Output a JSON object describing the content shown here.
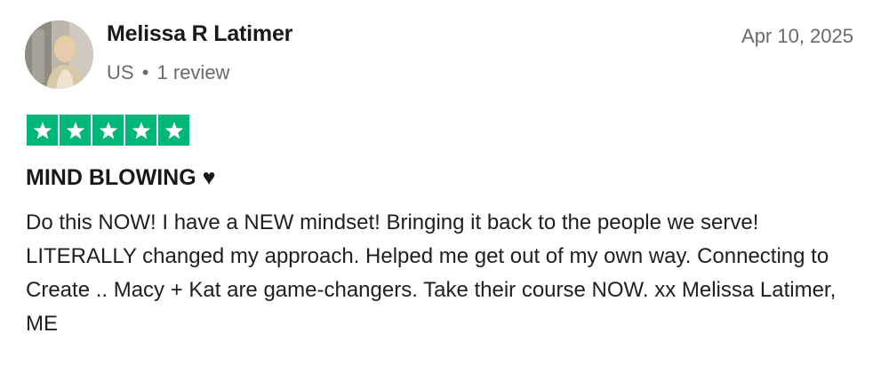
{
  "reviewer": {
    "name": "Melissa R Latimer",
    "country": "US",
    "separator": "•",
    "review_count": "1 review"
  },
  "review": {
    "date": "Apr 10, 2025",
    "rating": 5,
    "rating_max": 5,
    "title": "MIND BLOWING ♥",
    "body": "Do this NOW! I have a NEW mindset! Bringing it back to the people we serve! LITERALLY changed my approach. Helped me get out of my own way. Connecting to Create .. Macy + Kat are game-changers. Take their course NOW. xx Melissa Latimer, ME"
  },
  "colors": {
    "star_green": "#00b67a",
    "meta_gray": "#696a6a",
    "text": "#1a1a1a"
  },
  "icons": {
    "avatar": "avatar-photo",
    "star": "star-icon"
  }
}
